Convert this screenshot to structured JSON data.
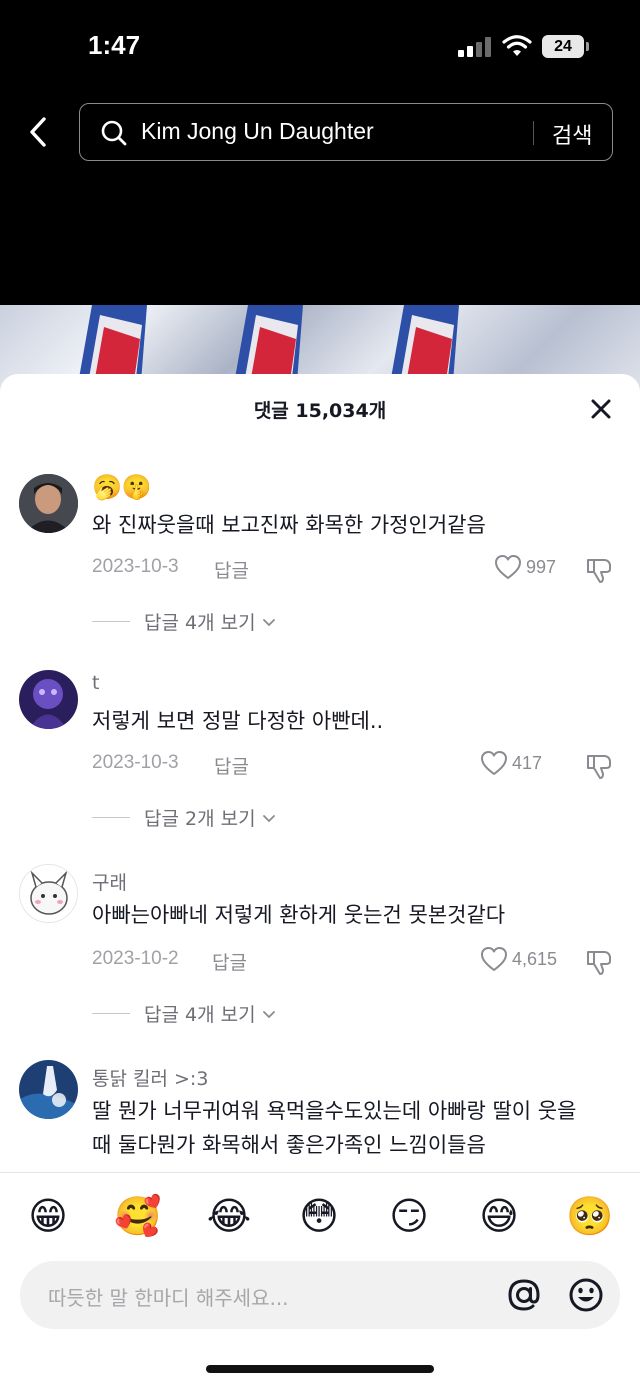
{
  "status_bar": {
    "time": "1:47",
    "battery": "24",
    "signal_icon": "cellular-signal-icon",
    "wifi_icon": "wifi-icon"
  },
  "search": {
    "back_icon": "chevron-left-icon",
    "icon": "search-icon",
    "query": "Kim Jong Un Daughter",
    "submit_label": "검색"
  },
  "comments_panel": {
    "title": "댓글 15,034개",
    "close_icon": "close-icon",
    "comments": [
      {
        "username": "🥱🤫",
        "text": "와 진짜웃을때 보고진짜 화목한 가정인거같음",
        "date": "2023-10-3",
        "reply_label": "답글",
        "likes": "997",
        "view_replies": "답글 4개 보기"
      },
      {
        "username": "t",
        "text": "저렇게 보면 정말 다정한 아빤데..",
        "date": "2023-10-3",
        "reply_label": "답글",
        "likes": "417",
        "view_replies": "답글 2개 보기"
      },
      {
        "username": "구래",
        "text": "아빠는아빠네 저렇게 환하게 웃는건 못본것같다",
        "date": "2023-10-2",
        "reply_label": "답글",
        "likes": "4,615",
        "view_replies": "답글 4개 보기"
      },
      {
        "username": "통닭 킬러 >:3",
        "text_line1": "딸 뭔가 너무귀여워 욕먹을수도있는데 아빠랑 딸이 웃을",
        "text_line2": "때 둘다뭔가 화목해서 좋은가족인 느낌이들음"
      }
    ]
  },
  "composer": {
    "emojis": [
      "😁",
      "🥰",
      "😂",
      "😳",
      "😏",
      "😅",
      "🥺"
    ],
    "placeholder": "따듯한 말 한마디 해주세요...",
    "mention_icon": "at-sign-icon",
    "emoji_picker_icon": "smiley-face-icon"
  },
  "colors": {
    "header_bg": "#000000",
    "sheet_bg": "#ffffff",
    "text_primary": "#161823",
    "text_secondary": "#8a8b91"
  }
}
